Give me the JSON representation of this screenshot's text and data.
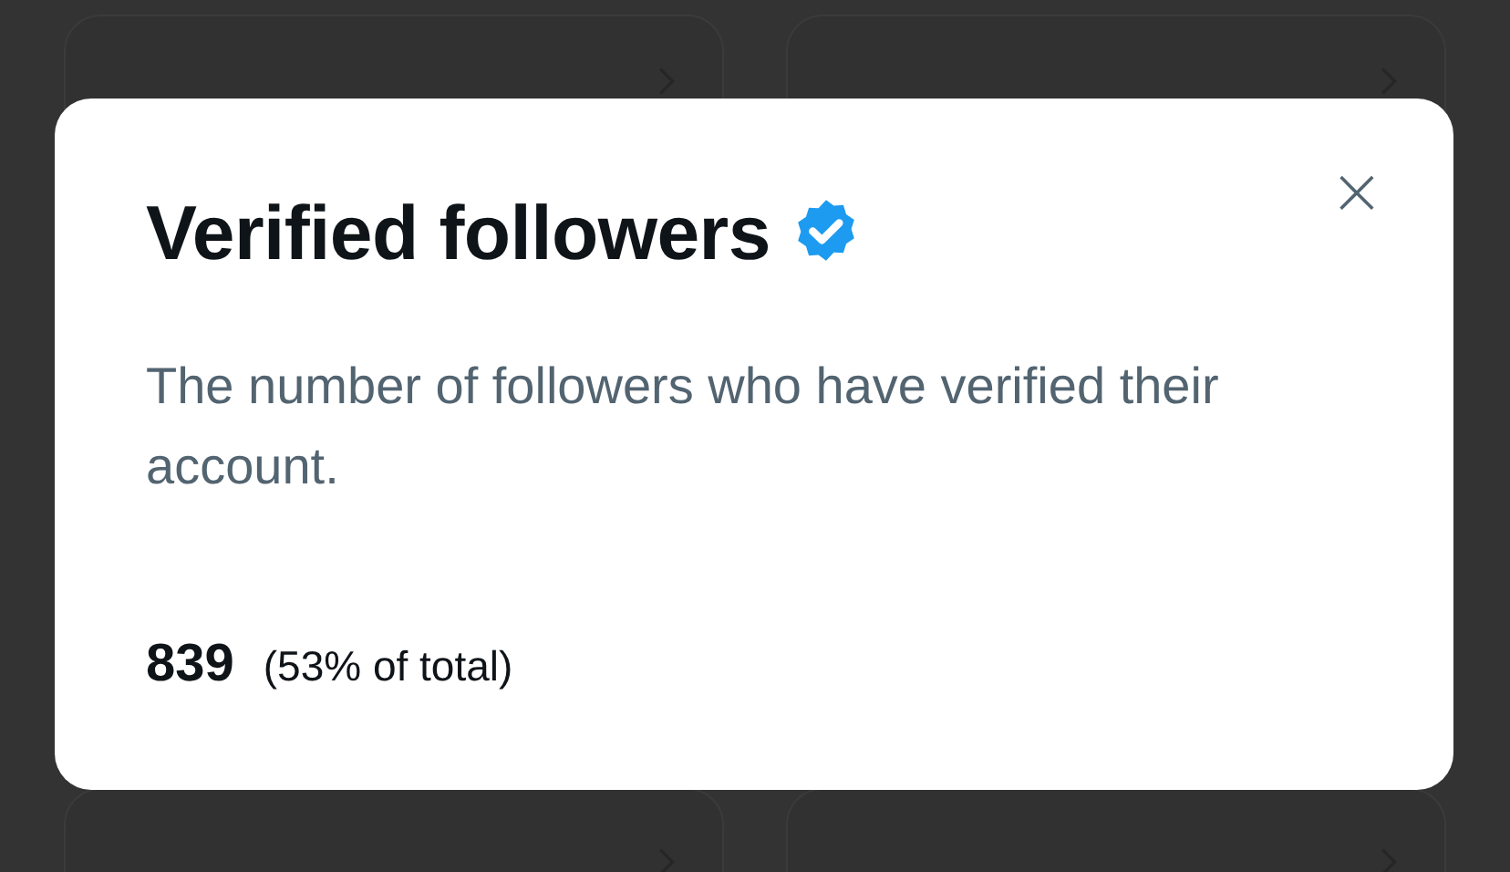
{
  "background_cards": [
    {
      "kind": "card"
    },
    {
      "kind": "card"
    },
    {
      "kind": "card"
    },
    {
      "kind": "card"
    }
  ],
  "dialog": {
    "title": "Verified followers",
    "verified": true,
    "close": "×",
    "description": "The number of followers who have verified their account.",
    "value": "839",
    "share": "(53% of total)"
  }
}
